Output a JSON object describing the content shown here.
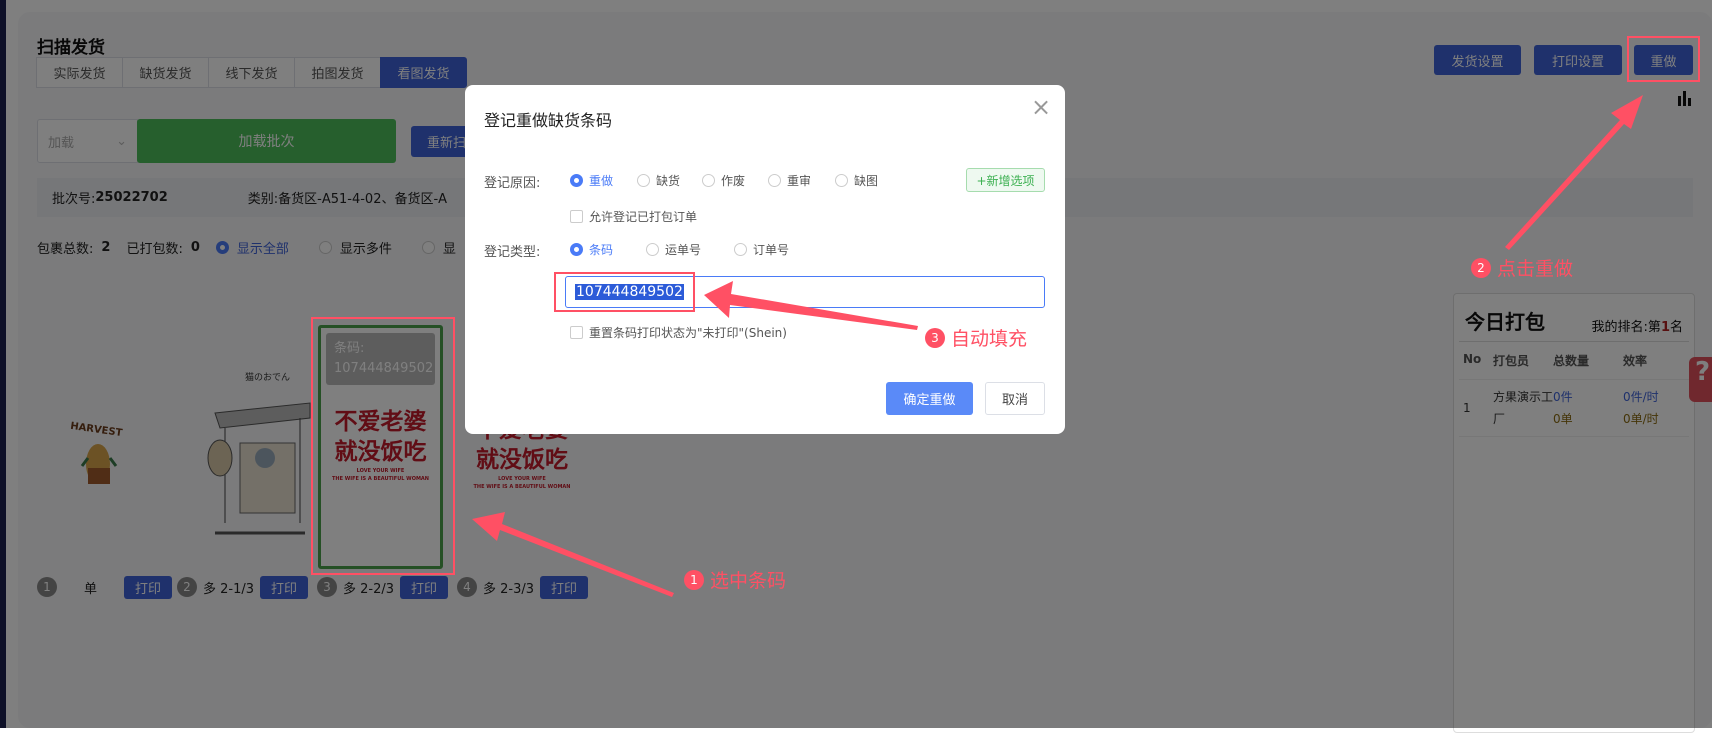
{
  "page": {
    "title": "扫描发货",
    "tabs": [
      "实际发货",
      "缺货发货",
      "线下发货",
      "拍图发货",
      "看图发货"
    ],
    "active_tab": "看图发货"
  },
  "toolbar": {
    "ship_settings": "发货设置",
    "print_settings": "打印设置",
    "redo": "重做"
  },
  "load": {
    "select_value": "加载",
    "load_batch": "加载批次",
    "rescan": "重新扫"
  },
  "info": {
    "batch_label": "批次号:",
    "batch_no": "25022702",
    "category_label": "类别:",
    "category_value": "备货区-A51-4-02、备货区-A"
  },
  "counts": {
    "total_label": "包裹总数:",
    "total": "2",
    "packed_label": "已打包数:",
    "packed": "0",
    "filters": [
      "显示全部",
      "显示多件",
      "显"
    ]
  },
  "items": [
    {
      "num": "1",
      "label": "单",
      "print": "打印"
    },
    {
      "num": "2",
      "label": "多 2-1/3",
      "print": "打印"
    },
    {
      "num": "3",
      "label": "多 2-2/3",
      "print": "打印"
    },
    {
      "num": "4",
      "label": "多 2-3/3",
      "print": "打印"
    }
  ],
  "images": {
    "barcode_label": "条码:",
    "barcode": "107444849502",
    "slogan1": "不爱老婆",
    "slogan2": "就没饭吃",
    "small1": "LOVE YOUR WIFE",
    "small2": "THE WIFE IS A BEAUTIFUL WOMAN",
    "stall_sign": "猫のおでん",
    "rabbit": "HARVEST"
  },
  "ranking": {
    "title": "今日打包",
    "rank_label": "我的排名:第",
    "rank": "1",
    "rank_suffix": "名",
    "columns": [
      "No",
      "打包员",
      "总数量",
      "效率"
    ],
    "rows": [
      {
        "no": "1",
        "packer": "方果演示工厂",
        "qty_pcs": "0件",
        "qty_orders": "0单",
        "rate_pcs": "0件/时",
        "rate_orders": "0单/时"
      }
    ]
  },
  "dialog": {
    "title": "登记重做缺货条码",
    "reason_label": "登记原因:",
    "reasons": [
      "重做",
      "缺货",
      "作废",
      "重审",
      "缺图"
    ],
    "selected_reason": "重做",
    "add_option": "+新增选项",
    "allow_packed": "允许登记已打包订单",
    "type_label": "登记类型:",
    "types": [
      "条码",
      "运单号",
      "订单号"
    ],
    "selected_type": "条码",
    "input_value": "107444849502",
    "reset_print": "重置条码打印状态为\"未打印\"(Shein)",
    "confirm": "确定重做",
    "cancel": "取消"
  },
  "annotations": [
    {
      "num": "1",
      "text": "选中条码"
    },
    {
      "num": "2",
      "text": "点击重做"
    },
    {
      "num": "3",
      "text": "自动填充"
    }
  ],
  "colors": {
    "primary": "#3f63d8",
    "success": "#4cbf5a",
    "annotation": "#ff5064",
    "dialog_primary": "#4a7bf7"
  }
}
